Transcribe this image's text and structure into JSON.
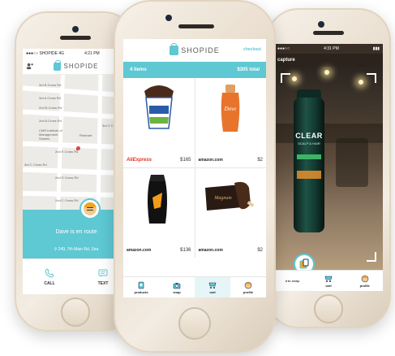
{
  "colors": {
    "accent": "#5ec8d3",
    "aliexpress": "#e43225",
    "orange": "#f0a423"
  },
  "left": {
    "status": {
      "carrier": "●●●○○ SHOPIDE  4G",
      "time": "4:21 PM",
      "battery": "▮▮▮"
    },
    "brand": "SHOPIDE",
    "map_labels": [
      "3rd B Cross Rd",
      "3rd A Cross Rd",
      "2nd B Cross Rd",
      "2nd A Cross Rd",
      "3rd C Cross Rd",
      "CMR Institute of Management Studies",
      "Redmart",
      "2nd E Cross Rd",
      "3rd C Cross Rd",
      "2nd D Cross Rd",
      "2nd C Cross Rd"
    ],
    "enroute": "Dave is en route",
    "address": "249, 7th Main Rd, Sira",
    "actions": [
      {
        "label": "CALL",
        "icon": "phone-icon"
      },
      {
        "label": "TEXT",
        "icon": "message-icon"
      }
    ]
  },
  "center": {
    "brand": "SHOPIDE",
    "checkout": "checkout",
    "items_count": "4 items",
    "total": "$305 total",
    "products": [
      {
        "name": "Ben & Jerry's ice cream",
        "store": "AliExpress",
        "price": "$165"
      },
      {
        "name": "Dove body wash",
        "store": "amazon.com",
        "price": "$2"
      },
      {
        "name": "Axe shower gel",
        "store": "amazon.com",
        "price": "$136"
      },
      {
        "name": "Magnum ice cream bar",
        "store": "amazon.com",
        "price": "$2"
      }
    ],
    "nav": [
      {
        "label": "products",
        "icon": "products-icon"
      },
      {
        "label": "snap",
        "icon": "camera-icon"
      },
      {
        "label": "cart",
        "icon": "cart-icon"
      },
      {
        "label": "profile",
        "icon": "profile-icon"
      }
    ]
  },
  "right": {
    "status": {
      "carrier": "●●●○○",
      "time": "4:31 PM",
      "battery": "▮▮▮"
    },
    "capture": "capture",
    "product_brand": "CLEAR",
    "product_line": "SCALP & HAIR",
    "nav": [
      {
        "label": "◂ to snap",
        "icon": "back-icon"
      },
      {
        "label": "cart",
        "icon": "cart-icon"
      },
      {
        "label": "profile",
        "icon": "profile-icon"
      }
    ]
  }
}
